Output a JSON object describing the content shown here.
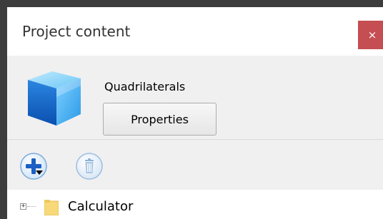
{
  "window": {
    "title": "Project content",
    "close_label": "×"
  },
  "project": {
    "name": "Quadrilaterals",
    "properties_label": "Properties",
    "icon": "cube-icon"
  },
  "toolbar": {
    "add_icon": "add-icon",
    "delete_icon": "trash-icon"
  },
  "tree": {
    "items": [
      {
        "label": "Calculator",
        "icon": "folder-icon",
        "expander": "+"
      }
    ]
  },
  "colors": {
    "close_button": "#c44e51",
    "accent_blue": "#1f6fd6",
    "folder": "#f7d97a"
  }
}
